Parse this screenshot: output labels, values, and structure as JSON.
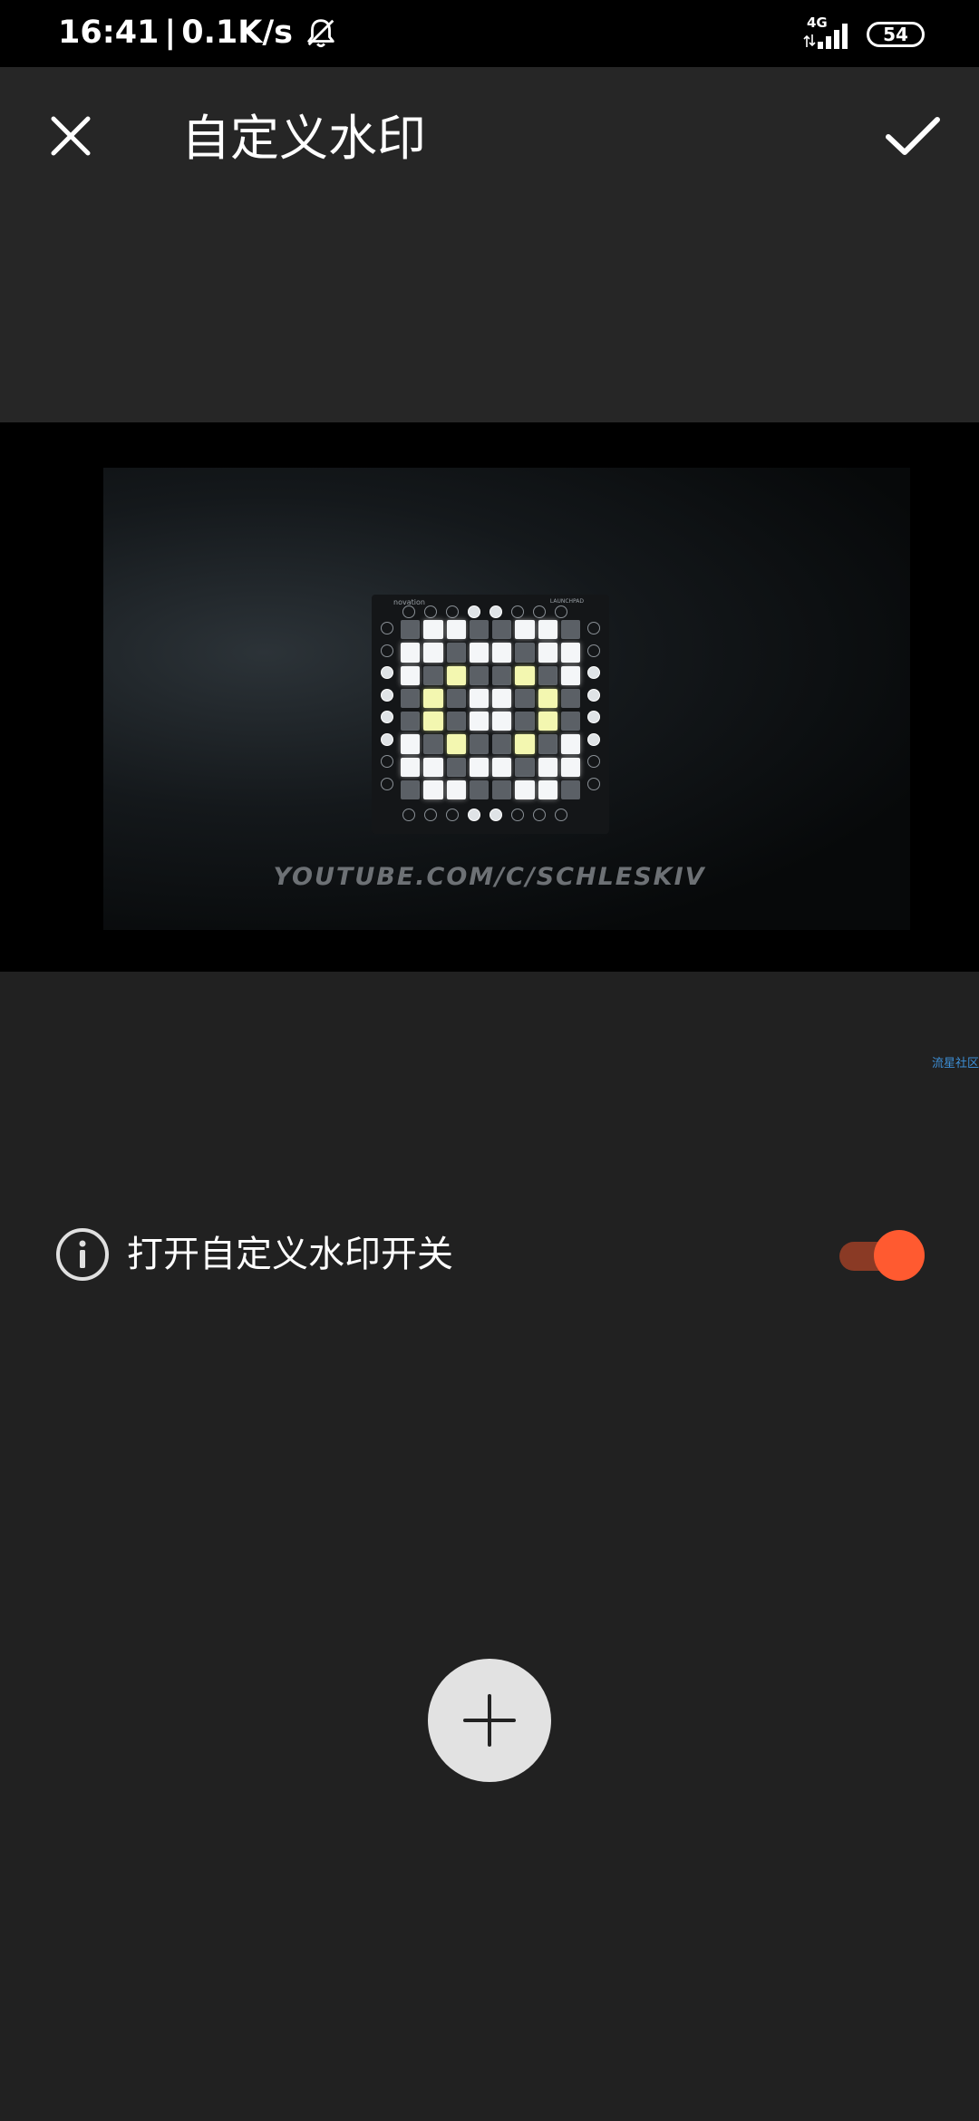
{
  "status_bar": {
    "time": "16:41",
    "separator": "|",
    "speed": "0.1K/s",
    "network_type": "4G",
    "battery": "54",
    "bell_icon": "bell-off-icon",
    "signal_icon": "signal-icon"
  },
  "app_bar": {
    "title": "自定义水印",
    "close_icon": "close-icon",
    "confirm_icon": "check-icon"
  },
  "preview": {
    "device_brand": "novation",
    "device_model": "LAUNCHPAD",
    "watermark_text": "YOUTUBE.COM/C/SCHLESKIV",
    "small_watermark": "流星社区"
  },
  "settings": {
    "toggle_label": "打开自定义水印开关",
    "toggle_on": true,
    "info_icon": "info-icon"
  },
  "add_button": {
    "icon": "plus-icon"
  },
  "colors": {
    "background": "#212121",
    "app_bar": "#262626",
    "accent": "#ff5a30",
    "toggle_track": "#8a3a25",
    "add_button": "#e2e2e2"
  }
}
